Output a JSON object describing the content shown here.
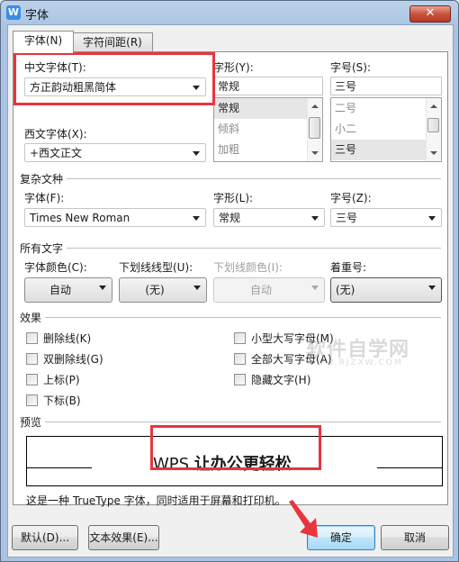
{
  "window": {
    "title": "字体",
    "app_icon": "wps-icon",
    "close_label": "✕"
  },
  "tabs": [
    {
      "label": "字体(N)",
      "active": true
    },
    {
      "label": "字符间距(R)",
      "active": false
    }
  ],
  "chinese_font": {
    "label": "中文字体(T):",
    "value": "方正韵动粗黑简体"
  },
  "western_font": {
    "label": "西文字体(X):",
    "value": "+西文正文"
  },
  "style": {
    "label": "字形(Y):",
    "value": "常规",
    "options": [
      "常规",
      "倾斜",
      "加粗"
    ],
    "selected": "常规"
  },
  "size": {
    "label": "字号(S):",
    "value": "三号",
    "options": [
      "二号",
      "小二",
      "三号"
    ],
    "selected": "三号"
  },
  "complex": {
    "group_label": "复杂文种",
    "font_label": "字体(F):",
    "font_value": "Times New Roman",
    "style_label": "字形(L):",
    "style_value": "常规",
    "size_label": "字号(Z):",
    "size_value": "三号"
  },
  "all_text": {
    "group_label": "所有文字",
    "font_color_label": "字体颜色(C):",
    "font_color_value": "自动",
    "underline_type_label": "下划线线型(U):",
    "underline_type_value": "(无)",
    "underline_color_label": "下划线颜色(I):",
    "underline_color_value": "自动",
    "emphasis_label": "着重号:",
    "emphasis_value": "(无)"
  },
  "effects": {
    "group_label": "效果",
    "left": [
      {
        "label": "删除线(K)",
        "checked": false
      },
      {
        "label": "双删除线(G)",
        "checked": false
      },
      {
        "label": "上标(P)",
        "checked": false
      },
      {
        "label": "下标(B)",
        "checked": false
      }
    ],
    "right": [
      {
        "label": "小型大写字母(M)",
        "checked": false
      },
      {
        "label": "全部大写字母(A)",
        "checked": false
      },
      {
        "label": "隐藏文字(H)",
        "checked": false
      }
    ]
  },
  "preview": {
    "group_label": "预览",
    "text_latin": "WPS",
    "text_cn": "让办公更轻松",
    "description": "这是一种 TrueType 字体，同时适用于屏幕和打印机。"
  },
  "buttons": {
    "default": "默认(D)...",
    "text_effects": "文本效果(E)...",
    "ok": "确定",
    "cancel": "取消"
  },
  "watermark": {
    "title": "软件自学网",
    "url": "WWW.RJZXW.COM"
  },
  "annotation_color": "#e8353d"
}
